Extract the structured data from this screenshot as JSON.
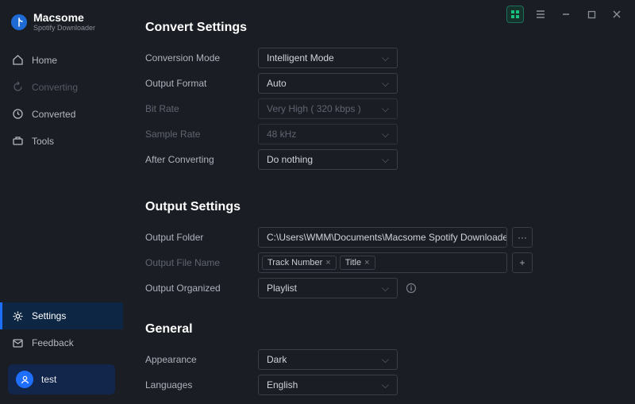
{
  "brand": {
    "title": "Macsome",
    "subtitle": "Spotify Downloader"
  },
  "nav": {
    "home": "Home",
    "converting": "Converting",
    "converted": "Converted",
    "tools": "Tools",
    "settings": "Settings",
    "feedback": "Feedback"
  },
  "user": {
    "name": "test"
  },
  "sections": {
    "convert": {
      "heading": "Convert Settings",
      "labels": {
        "mode": "Conversion Mode",
        "format": "Output Format",
        "bitrate": "Bit Rate",
        "samplerate": "Sample Rate",
        "after": "After Converting"
      },
      "values": {
        "mode": "Intelligent Mode",
        "format": "Auto",
        "bitrate": "Very High ( 320 kbps )",
        "samplerate": "48 kHz",
        "after": "Do nothing"
      }
    },
    "output": {
      "heading": "Output Settings",
      "labels": {
        "folder": "Output Folder",
        "filename": "Output File Name",
        "organized": "Output Organized"
      },
      "values": {
        "folder": "C:\\Users\\WMM\\Documents\\Macsome Spotify Downloader",
        "organized": "Playlist",
        "tags": {
          "track": "Track Number",
          "title": "Title"
        }
      }
    },
    "general": {
      "heading": "General",
      "labels": {
        "appearance": "Appearance",
        "languages": "Languages"
      },
      "values": {
        "appearance": "Dark",
        "languages": "English"
      }
    }
  }
}
